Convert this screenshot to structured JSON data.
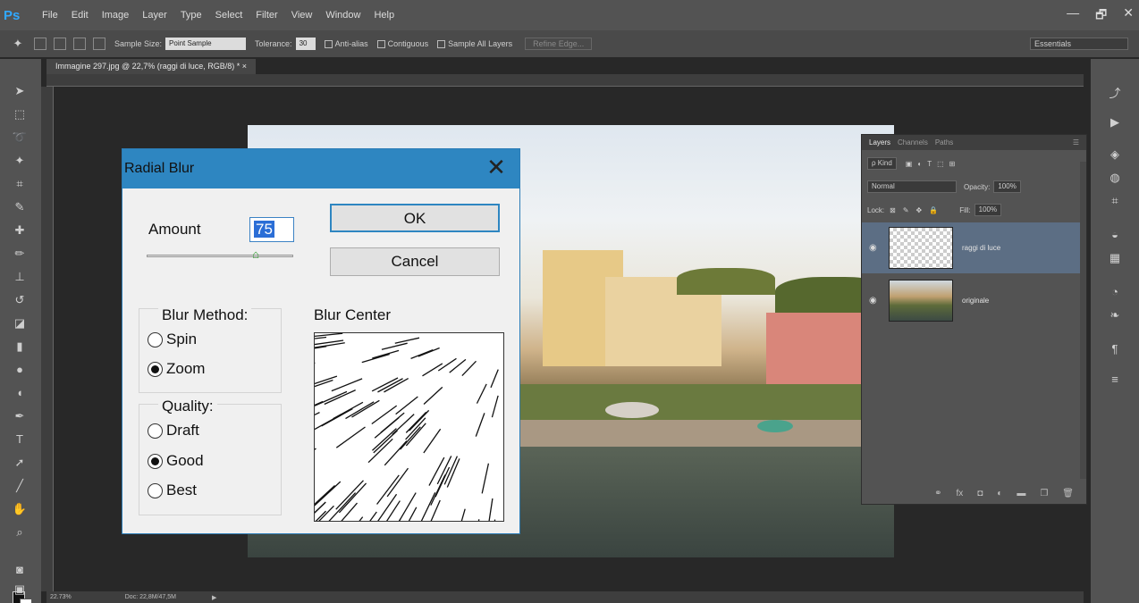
{
  "menubar": {
    "logo": "Ps",
    "items": [
      "File",
      "Edit",
      "Image",
      "Layer",
      "Type",
      "Select",
      "Filter",
      "View",
      "Window",
      "Help"
    ],
    "window_controls": [
      "—",
      "🗗",
      "✕"
    ]
  },
  "options": {
    "sample_size_label": "Sample Size:",
    "sample_size_value": "Point Sample",
    "tolerance_label": "Tolerance:",
    "tolerance_value": "30",
    "anti_alias": "Anti-alias",
    "contiguous": "Contiguous",
    "sample_all_layers": "Sample All Layers",
    "refine_edge": "Refine Edge...",
    "workspace": "Essentials"
  },
  "document": {
    "tab_title": "Immagine 297.jpg @ 22,7% (raggi di luce, RGB/8) * ×",
    "zoom": "22.73%",
    "doc_info": "Doc: 22,8M/47,5M"
  },
  "dialog": {
    "title": "Radial Blur",
    "amount_label": "Amount",
    "amount_value": "75",
    "ok": "OK",
    "cancel": "Cancel",
    "blur_method_title": "Blur Method:",
    "blur_methods": [
      {
        "label": "Spin",
        "selected": false
      },
      {
        "label": "Zoom",
        "selected": true
      }
    ],
    "quality_title": "Quality:",
    "qualities": [
      {
        "label": "Draft",
        "selected": false
      },
      {
        "label": "Good",
        "selected": true
      },
      {
        "label": "Best",
        "selected": false
      }
    ],
    "blur_center_label": "Blur Center"
  },
  "layers_panel": {
    "tabs": [
      "Layers",
      "Channels",
      "Paths"
    ],
    "filter_kind": "ρ Kind",
    "blend_mode": "Normal",
    "opacity_label": "Opacity:",
    "opacity_value": "100%",
    "lock_label": "Lock:",
    "fill_label": "Fill:",
    "fill_value": "100%",
    "layers": [
      {
        "name": "raggi di luce",
        "selected": true
      },
      {
        "name": "originale",
        "selected": false
      }
    ],
    "footer_icons": [
      "link-icon",
      "fx-icon",
      "mask-icon",
      "adjustment-icon",
      "folder-icon",
      "new-layer-icon",
      "trash-icon"
    ]
  }
}
